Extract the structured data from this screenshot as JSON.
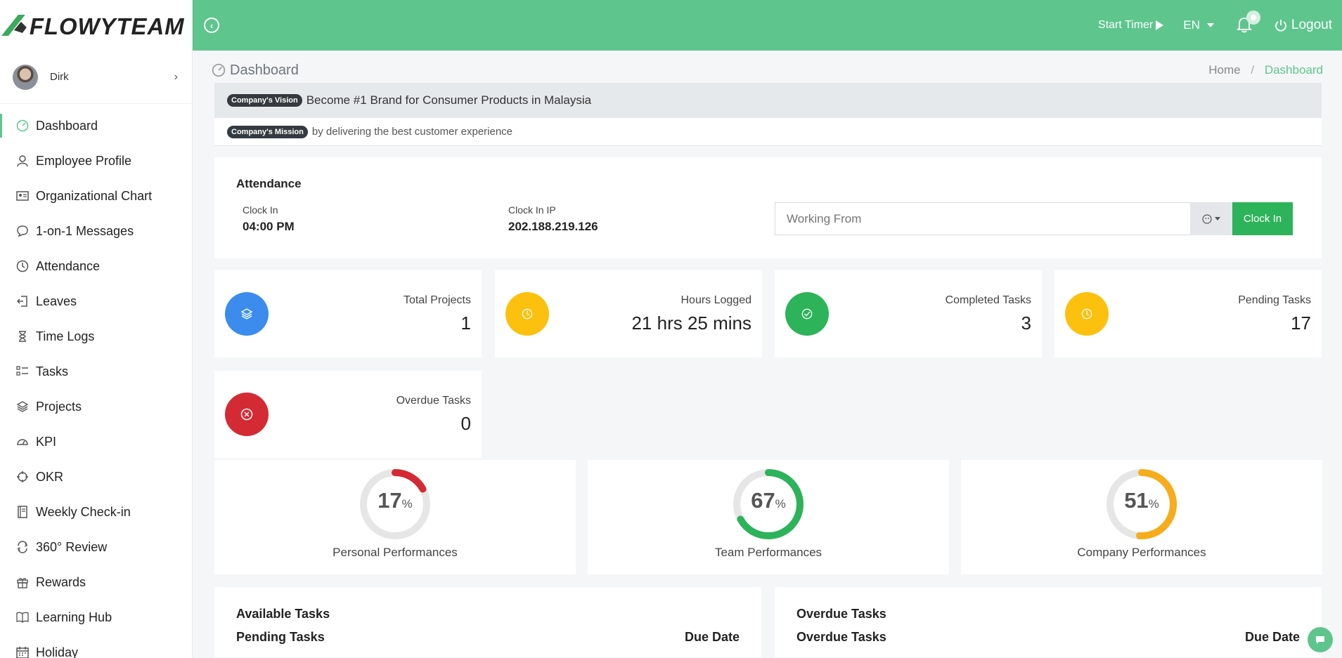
{
  "brand": {
    "name": "FLOWYTEAM"
  },
  "user": {
    "name": "Dirk"
  },
  "sidebar": {
    "items": [
      {
        "label": "Dashboard",
        "icon": "dashboard-icon",
        "active": true
      },
      {
        "label": "Employee Profile",
        "icon": "user-icon"
      },
      {
        "label": "Organizational Chart",
        "icon": "id-card-icon"
      },
      {
        "label": "1-on-1 Messages",
        "icon": "chat-bubble-icon"
      },
      {
        "label": "Attendance",
        "icon": "clock-icon"
      },
      {
        "label": "Leaves",
        "icon": "sign-out-icon"
      },
      {
        "label": "Time Logs",
        "icon": "hourglass-icon"
      },
      {
        "label": "Tasks",
        "icon": "task-list-icon"
      },
      {
        "label": "Projects",
        "icon": "layers-icon"
      },
      {
        "label": "KPI",
        "icon": "gauge-icon"
      },
      {
        "label": "OKR",
        "icon": "target-icon"
      },
      {
        "label": "Weekly Check-in",
        "icon": "notebook-icon"
      },
      {
        "label": "360° Review",
        "icon": "refresh-icon"
      },
      {
        "label": "Rewards",
        "icon": "gift-icon"
      },
      {
        "label": "Learning Hub",
        "icon": "book-icon"
      },
      {
        "label": "Holiday",
        "icon": "calendar-icon"
      }
    ]
  },
  "topbar": {
    "start_timer": "Start Timer",
    "language": "EN",
    "logout": "Logout"
  },
  "page": {
    "title": "Dashboard",
    "breadcrumb": {
      "home": "Home",
      "current": "Dashboard"
    }
  },
  "vision": {
    "badge": "Company's Vision",
    "text": "Become #1 Brand for Consumer Products in Malaysia"
  },
  "mission": {
    "badge": "Company's Mission",
    "text": "by delivering the best customer experience"
  },
  "attendance": {
    "title": "Attendance",
    "clock_in_label": "Clock In",
    "clock_in_value": "04:00 PM",
    "ip_label": "Clock In IP",
    "ip_value": "202.188.219.126",
    "working_from_placeholder": "Working From",
    "clock_in_button": "Clock In"
  },
  "stats": [
    {
      "label": "Total Projects",
      "value": "1",
      "color": "#3b8ced",
      "icon": "layers-icon"
    },
    {
      "label": "Hours Logged",
      "value": "21 hrs 25 mins",
      "color": "#fcc00e",
      "icon": "clock-icon"
    },
    {
      "label": "Completed Tasks",
      "value": "3",
      "color": "#2db359",
      "icon": "check-circle-icon"
    },
    {
      "label": "Pending Tasks",
      "value": "17",
      "color": "#fcc00e",
      "icon": "clock-icon"
    },
    {
      "label": "Overdue Tasks",
      "value": "0",
      "color": "#d42a33",
      "icon": "x-circle-icon"
    }
  ],
  "performance": [
    {
      "label": "Personal Performances",
      "value": 17,
      "unit": "%",
      "color": "#d42a33"
    },
    {
      "label": "Team Performances",
      "value": 67,
      "unit": "%",
      "color": "#2db359"
    },
    {
      "label": "Company Performances",
      "value": 51,
      "unit": "%",
      "color": "#f7ac1c"
    }
  ],
  "tasks_cards": [
    {
      "title": "Available Tasks",
      "col1": "Pending Tasks",
      "col2": "Due Date"
    },
    {
      "title": "Overdue Tasks",
      "col1": "Overdue Tasks",
      "col2": "Due Date"
    }
  ],
  "colors": {
    "brand": "#5ec58d",
    "sidebar_bg": "#ffffff",
    "page_bg": "#f5f6f8"
  }
}
